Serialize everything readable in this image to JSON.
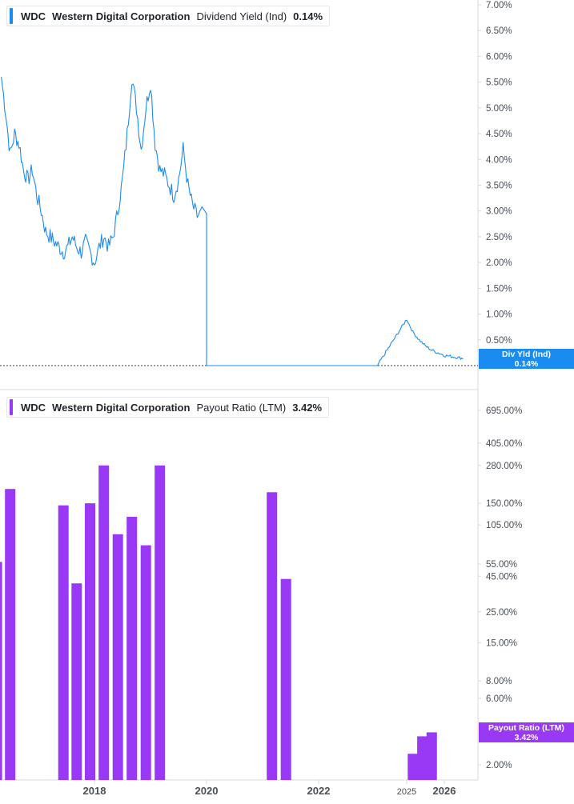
{
  "colors": {
    "yield_line": "#1a8cf0",
    "payout_bar": "#9a39f5",
    "grid": "#e6e8eb",
    "axis_text": "#4a4f55",
    "divider": "#d5d9de"
  },
  "top_legend": {
    "ticker": "WDC",
    "company": "Western Digital Corporation",
    "metric": "Dividend Yield (Ind)",
    "value": "0.14%"
  },
  "bottom_legend": {
    "ticker": "WDC",
    "company": "Western Digital Corporation",
    "metric": "Payout Ratio (LTM)",
    "value": "3.42%"
  },
  "top_tag": {
    "label": "Div Yld (Ind)",
    "value": "0.14%"
  },
  "bottom_tag": {
    "label": "Payout Ratio (LTM)",
    "value": "3.42%"
  },
  "chart_data": [
    {
      "type": "line",
      "title": "Dividend Yield (Ind)",
      "xlabel": "",
      "ylabel": "",
      "y_unit": "%",
      "ylim": [
        0,
        7
      ],
      "y_ticks": [
        "7.00%",
        "6.50%",
        "6.00%",
        "5.50%",
        "5.00%",
        "4.50%",
        "4.00%",
        "3.50%",
        "3.00%",
        "2.50%",
        "2.00%",
        "1.50%",
        "1.00%",
        "0.50%",
        "0.00%"
      ],
      "grid": false,
      "series": [
        {
          "name": "Div Yld (Ind)",
          "x": [
            "2016-04",
            "2016-05",
            "2016-06",
            "2016-07",
            "2016-08",
            "2016-09",
            "2016-10",
            "2016-11",
            "2016-12",
            "2017-01",
            "2017-02",
            "2017-03",
            "2017-04",
            "2017-05",
            "2017-06",
            "2017-07",
            "2017-08",
            "2017-09",
            "2017-10",
            "2017-11",
            "2017-12",
            "2018-01",
            "2018-02",
            "2018-03",
            "2018-04",
            "2018-05",
            "2018-06",
            "2018-07",
            "2018-08",
            "2018-09",
            "2018-10",
            "2018-11",
            "2018-12",
            "2019-01",
            "2019-02",
            "2019-03",
            "2019-04",
            "2019-05",
            "2019-06",
            "2019-07",
            "2019-08",
            "2019-09",
            "2019-10",
            "2019-11",
            "2019-12",
            "2020-01",
            "2020-03",
            "2020-04",
            "2020-06",
            "2021-01",
            "2022-01",
            "2023-01",
            "2024-01",
            "2025-01",
            "2025-03",
            "2025-05",
            "2025-07",
            "2025-09",
            "2025-11",
            "2026-01",
            "2026-03",
            "2026-05"
          ],
          "values": [
            5.6,
            4.9,
            4.1,
            4.5,
            4.3,
            3.8,
            3.6,
            3.8,
            3.3,
            3.0,
            2.6,
            2.5,
            2.4,
            2.3,
            2.2,
            2.3,
            2.5,
            2.3,
            2.2,
            2.4,
            2.2,
            2.0,
            2.3,
            2.5,
            2.3,
            2.5,
            3.0,
            3.6,
            4.5,
            5.6,
            5.0,
            4.2,
            5.0,
            5.5,
            4.3,
            3.8,
            3.7,
            3.5,
            3.3,
            3.6,
            4.2,
            3.5,
            3.1,
            2.9,
            2.95,
            0.0,
            0.0,
            0.0,
            0.0,
            0.0,
            0.0,
            0.0,
            0.0,
            0.9,
            0.65,
            0.5,
            0.38,
            0.3,
            0.25,
            0.2,
            0.17,
            0.14
          ]
        }
      ]
    },
    {
      "type": "bar",
      "title": "Payout Ratio (LTM)",
      "xlabel": "",
      "ylabel": "",
      "y_unit": "%",
      "y_scale": "log",
      "y_ticks": [
        "695.00%",
        "405.00%",
        "280.00%",
        "150.00%",
        "105.00%",
        "55.00%",
        "45.00%",
        "25.00%",
        "15.00%",
        "8.00%",
        "6.00%",
        "2.00%"
      ],
      "x_ticks": [
        "2018",
        "2020",
        "2022",
        "2025",
        "2026"
      ],
      "grid": false,
      "series": [
        {
          "name": "Payout Ratio (LTM)",
          "x": [
            "2016-03",
            "2016-06",
            "2017-06",
            "2017-09",
            "2017-12",
            "2018-03",
            "2018-06",
            "2018-09",
            "2018-12",
            "2019-03",
            "2021-03",
            "2021-06",
            "2025-03",
            "2025-06",
            "2025-09"
          ],
          "values": [
            57,
            190,
            145,
            40,
            150,
            280,
            90,
            120,
            75,
            280,
            180,
            43,
            2.4,
            3.2,
            3.42
          ]
        }
      ]
    }
  ]
}
